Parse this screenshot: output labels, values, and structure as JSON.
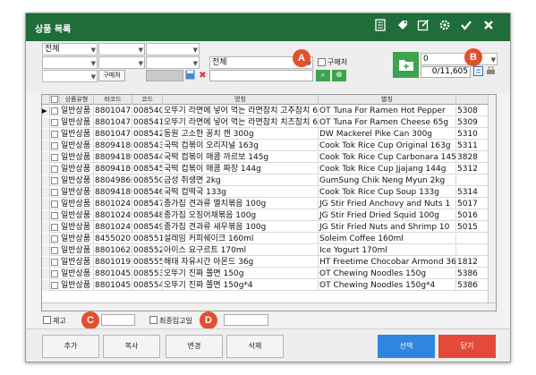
{
  "window": {
    "title": "상품 목록",
    "accent_color": "#1f6d3a",
    "toolbar_icons": [
      "book-icon",
      "tag-icon",
      "edit-icon",
      "settings-gear-icon",
      "check-icon",
      "close-icon"
    ]
  },
  "filters": {
    "category_select": "전체",
    "purchase_button": "구매처",
    "search_select": "전체",
    "purchase_checkbox_label": "구매처",
    "page_select": "0",
    "count_display": "0/11,605"
  },
  "callouts": {
    "a": "A",
    "b": "B",
    "c": "C",
    "d": "D"
  },
  "table": {
    "headers": [
      "상품유형",
      "바코드",
      "코드",
      "명칭",
      "별칭"
    ],
    "rows": [
      {
        "type": "일반상품",
        "barcode": "88010471",
        "code": "008540",
        "name": "오뚜기 라면에 넣어 먹는 라면참치 고추참치 6",
        "alias": "OT Tuna For Ramen Hot Pepper",
        "extra": "5308"
      },
      {
        "type": "일반상품",
        "barcode": "88010471",
        "code": "008541",
        "name": "오뚜기 라면에 넣어 먹는 라면참치 치즈참치 6",
        "alias": "OT Tuna For Ramen Cheese 65g",
        "extra": "5309"
      },
      {
        "type": "일반상품",
        "barcode": "88010471",
        "code": "008542",
        "name": "동원 고소한 꽁치 캔 300g",
        "alias": "DW Mackerel Pike Can 300g",
        "extra": "5310"
      },
      {
        "type": "일반상품",
        "barcode": "88094180",
        "code": "008543",
        "name": "국떡 컵볶이 오리지널 163g",
        "alias": "Cook Tok Rice Cup Original 163g",
        "extra": "5311"
      },
      {
        "type": "일반상품",
        "barcode": "88094180",
        "code": "008544",
        "name": "국떡 컵볶이 매콤 까르보 145g",
        "alias": "Cook Tok Rice Cup Carbonara 145",
        "extra": "3828"
      },
      {
        "type": "일반상품",
        "barcode": "88094180",
        "code": "008545",
        "name": "국떡 컵볶이 매콤 짜장 144g",
        "alias": "Cook Tok Rice Cup Jjajang 144g",
        "extra": "5312"
      },
      {
        "type": "일반상품",
        "barcode": "88049860",
        "code": "008550",
        "name": "금성 취생면 2kg",
        "alias": "GumSung Chik Neng Myun 2kg",
        "extra": ""
      },
      {
        "type": "일반상품",
        "barcode": "88094180",
        "code": "008546",
        "name": "국떡 컵떡국 133g",
        "alias": "Cook Tok Rice Cup Soup 133g",
        "extra": "5314"
      },
      {
        "type": "일반상품",
        "barcode": "88010249",
        "code": "008547",
        "name": "종가집 견과류 멸치볶음 100g",
        "alias": "JG Stir Fried Anchovy and Nuts 1",
        "extra": "5017"
      },
      {
        "type": "일반상품",
        "barcode": "88010249",
        "code": "008548",
        "name": "종가집 오징어채볶음 100g",
        "alias": "JG Stir Fried Dried Squid 100g",
        "extra": "5016"
      },
      {
        "type": "일반상품",
        "barcode": "88010249",
        "code": "008549",
        "name": "종가집 견과류 새우볶음 100g",
        "alias": "JG Stir Fried Nuts and Shrimp 10",
        "extra": "5015"
      },
      {
        "type": "일반상품",
        "barcode": "84550207",
        "code": "008551",
        "name": "설레임 커피쉐이크 160ml",
        "alias": "Soleim Coffee 160ml",
        "extra": ""
      },
      {
        "type": "일반상품",
        "barcode": "88010624",
        "code": "008552",
        "name": "아이스 요구르트 170ml",
        "alias": "Ice Yogurt 170ml",
        "extra": ""
      },
      {
        "type": "일반상품",
        "barcode": "88010192",
        "code": "008555",
        "name": "해태 자유시간 아몬드 36g",
        "alias": "HT Freetime Chocobar Armond 36",
        "extra": "1812"
      },
      {
        "type": "일반상품",
        "barcode": "88010455",
        "code": "008553",
        "name": "오뚜기 진짜 쫄면 150g",
        "alias": "OT Chewing Noodles 150g",
        "extra": "5386"
      },
      {
        "type": "일반상품",
        "barcode": "88010455",
        "code": "008554",
        "name": "오뚜기 진짜 쫄면 150g*4",
        "alias": "OT Chewing Noodles 150g*4",
        "extra": "5386"
      }
    ]
  },
  "bottom": {
    "stock_label": "재고",
    "last_in_label": "최종입고일"
  },
  "footer": {
    "add": "추가",
    "copy": "복사",
    "change": "변경",
    "delete": "삭제",
    "select": "선택",
    "close": "닫기"
  }
}
